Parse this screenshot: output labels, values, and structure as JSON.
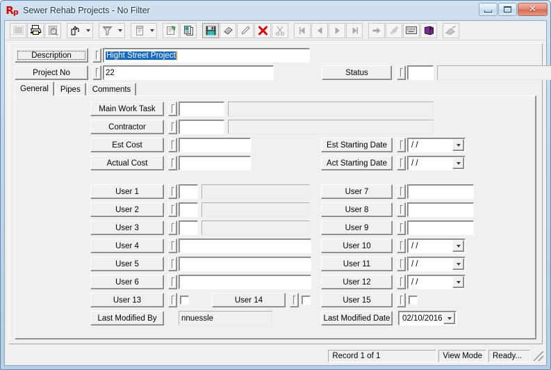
{
  "window": {
    "title": "Sewer Rehab Projects - No Filter",
    "app_icon": "rp-logo-icon",
    "minimize_label": "Minimize",
    "maximize_label": "Restore",
    "close_label": "Close"
  },
  "toolbar": {
    "items": [
      {
        "icon": "select-all-icon",
        "label": "Select",
        "disabled": true,
        "framed": true
      },
      {
        "icon": "printer-icon",
        "label": "Print",
        "disabled": false,
        "framed": true
      },
      {
        "icon": "print-preview-icon",
        "label": "Print Preview",
        "disabled": true,
        "framed": true
      },
      {
        "icon": "sort-icon",
        "label": "Sort",
        "disabled": false,
        "framed": true,
        "dropdown": true
      },
      {
        "icon": "filter-funnel-icon",
        "label": "Filter",
        "disabled": false,
        "framed": true,
        "dropdown": true
      },
      {
        "icon": "report-icon",
        "label": "Report",
        "disabled": true,
        "framed": true,
        "dropdown": true
      },
      {
        "icon": "properties-icon",
        "label": "Properties",
        "disabled": false,
        "framed": true
      },
      {
        "icon": "copy-records-icon",
        "label": "Copy Record",
        "disabled": false,
        "framed": true
      },
      {
        "icon": "save-disk-icon",
        "label": "Save",
        "disabled": false,
        "framed": true,
        "pressed": true
      },
      {
        "icon": "new-record-icon",
        "label": "New Record",
        "disabled": false,
        "framed": true
      },
      {
        "icon": "edit-pencil-icon",
        "label": "Edit",
        "disabled": false,
        "framed": true
      },
      {
        "icon": "delete-x-icon",
        "label": "Delete",
        "disabled": false,
        "framed": true
      },
      {
        "icon": "scissors-cut-icon",
        "label": "Cut",
        "disabled": true,
        "framed": true
      },
      {
        "icon": "first-record-icon",
        "label": "First Record",
        "disabled": true,
        "framed": true
      },
      {
        "icon": "previous-record-icon",
        "label": "Previous Record",
        "disabled": true,
        "framed": true
      },
      {
        "icon": "next-record-icon",
        "label": "Next Record",
        "disabled": true,
        "framed": true
      },
      {
        "icon": "last-record-icon",
        "label": "Last Record",
        "disabled": true,
        "framed": true
      },
      {
        "icon": "goto-record-icon",
        "label": "Go To",
        "disabled": true,
        "framed": true
      },
      {
        "icon": "link-attachment-icon",
        "label": "Attachments",
        "disabled": true,
        "framed": true
      },
      {
        "icon": "keyboard-icon",
        "label": "Keyboard Entry",
        "disabled": false,
        "framed": true
      },
      {
        "icon": "lookup-book-icon",
        "label": "Lookup Tables",
        "disabled": false,
        "framed": true
      },
      {
        "icon": "export-icon",
        "label": "Export",
        "disabled": true,
        "framed": true
      }
    ]
  },
  "header": {
    "description": {
      "label": "Description",
      "value": "Hight Street Project",
      "selected": true
    },
    "project_no": {
      "label": "Project No",
      "value": "22"
    },
    "status": {
      "label": "Status",
      "code_value": "",
      "desc_value": ""
    }
  },
  "tabs": [
    {
      "label": "General",
      "active": true
    },
    {
      "label": "Pipes",
      "active": false
    },
    {
      "label": "Comments",
      "active": false
    }
  ],
  "general": {
    "left_rows": [
      {
        "label": "Main Work Task",
        "type": "code-desc",
        "code": "",
        "desc": ""
      },
      {
        "label": "Contractor",
        "type": "code-desc",
        "code": "",
        "desc": ""
      },
      {
        "label": "Est Cost",
        "type": "text",
        "value": ""
      },
      {
        "label": "Actual Cost",
        "type": "text",
        "value": ""
      },
      {
        "label": "User 1",
        "type": "code-desc",
        "code": "",
        "desc": ""
      },
      {
        "label": "User 2",
        "type": "code-desc",
        "code": "",
        "desc": ""
      },
      {
        "label": "User 3",
        "type": "code-desc",
        "code": "",
        "desc": ""
      },
      {
        "label": "User 4",
        "type": "text",
        "value": ""
      },
      {
        "label": "User 5",
        "type": "text",
        "value": ""
      },
      {
        "label": "User 6",
        "type": "text",
        "value": ""
      }
    ],
    "right_rows": [
      {
        "label": "Est Starting Date",
        "type": "date",
        "value": "/  /"
      },
      {
        "label": "Act Starting Date",
        "type": "date",
        "value": "/  /"
      },
      {
        "label": "User 7",
        "type": "text",
        "value": ""
      },
      {
        "label": "User 8",
        "type": "text",
        "value": ""
      },
      {
        "label": "User 9",
        "type": "text",
        "value": ""
      },
      {
        "label": "User 10",
        "type": "date",
        "value": "/  /"
      },
      {
        "label": "User 11",
        "type": "date",
        "value": "/  /"
      },
      {
        "label": "User 12",
        "type": "date",
        "value": "/  /"
      }
    ],
    "checkbox_row": [
      {
        "label": "User 13",
        "checked": false
      },
      {
        "label": "User 14",
        "checked": false
      },
      {
        "label": "User 15",
        "checked": false
      }
    ],
    "last_modified_by": {
      "label": "Last Modified By",
      "value": "nnuessle"
    },
    "last_modified_date": {
      "label": "Last Modified Date",
      "value": "02/10/2016"
    }
  },
  "statusbar": {
    "record": "Record 1 of 1",
    "mode": "View Mode",
    "state": "Ready..."
  },
  "colors": {
    "face": "#f0f0f0",
    "selection": "#1569c7",
    "accent_red": "#d40000",
    "frame": "#8ba7bd"
  }
}
